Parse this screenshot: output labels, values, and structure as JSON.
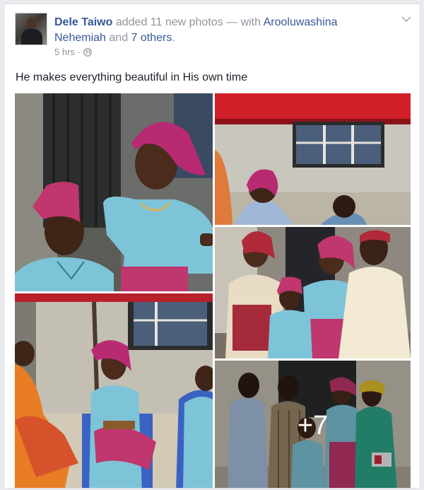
{
  "post": {
    "author": "Dele Taiwo",
    "action": "added 11 new photos",
    "with_sep": "— with",
    "tagged_name": "Arooluwashina Nehemiah",
    "and_text": "and",
    "others": "7 others",
    "period": ".",
    "time": "5 hrs",
    "time_sep": "·",
    "privacy_icon": "globe-icon",
    "menu_icon": "chevron-down-icon",
    "status_text": "He makes everything beautiful in His own time"
  },
  "photos": {
    "more_count": "+7"
  },
  "colors": {
    "link": "#365899",
    "meta": "#90949c",
    "text": "#1d2129",
    "background": "#e9ebee"
  }
}
